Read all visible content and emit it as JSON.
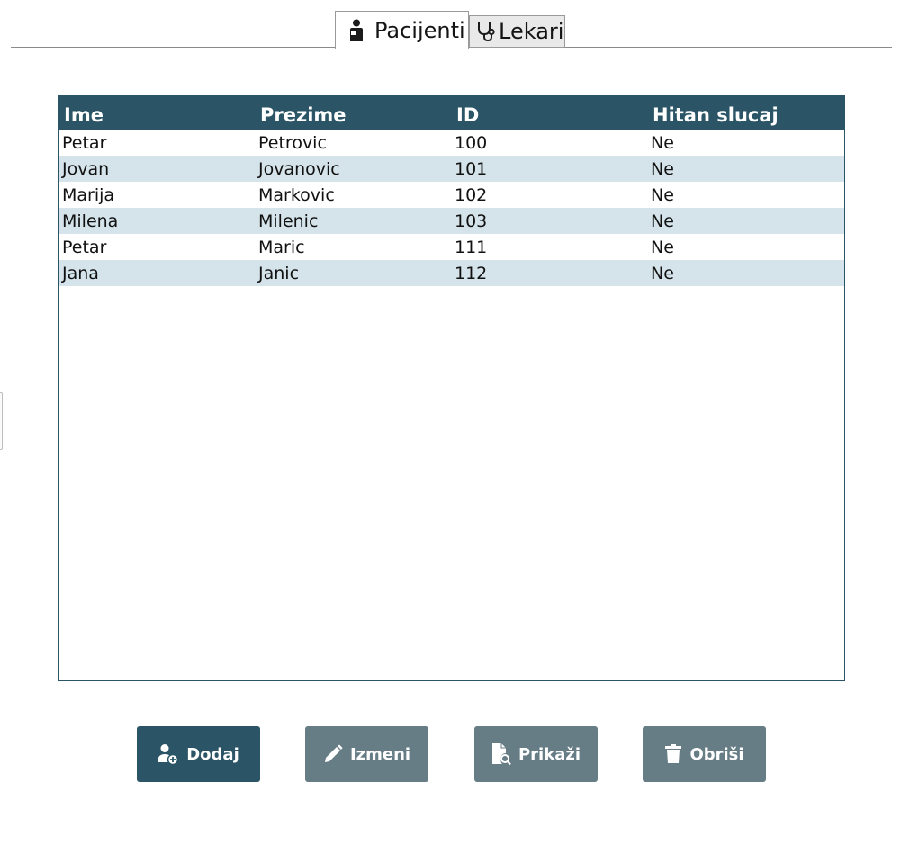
{
  "tabs": [
    {
      "label": "Pacijenti",
      "icon": "patient-icon",
      "selected": true
    },
    {
      "label": "Lekari",
      "icon": "stethoscope-icon",
      "selected": false
    }
  ],
  "table": {
    "columns": [
      "Ime",
      "Prezime",
      "ID",
      "Hitan slucaj"
    ],
    "rows": [
      [
        "Petar",
        "Petrovic",
        "100",
        "Ne"
      ],
      [
        "Jovan",
        "Jovanovic",
        "101",
        "Ne"
      ],
      [
        "Marija",
        "Markovic",
        "102",
        "Ne"
      ],
      [
        "Milena",
        "Milenic",
        "103",
        "Ne"
      ],
      [
        "Petar",
        "Maric",
        "111",
        "Ne"
      ],
      [
        "Jana",
        "Janic",
        "112",
        "Ne"
      ]
    ]
  },
  "actions": {
    "dodaj": {
      "label": "Dodaj",
      "icon": "add-user-icon"
    },
    "izmeni": {
      "label": "Izmeni",
      "icon": "pencil-icon"
    },
    "prikazi": {
      "label": "Prikaži",
      "icon": "document-search-icon"
    },
    "obrisi": {
      "label": "Obriši",
      "icon": "trash-icon"
    }
  },
  "colors": {
    "header_bg": "#2b5566",
    "alt_row_bg": "#d4e4ea",
    "primary_button": "#2b5566",
    "secondary_button": "#667d86"
  }
}
